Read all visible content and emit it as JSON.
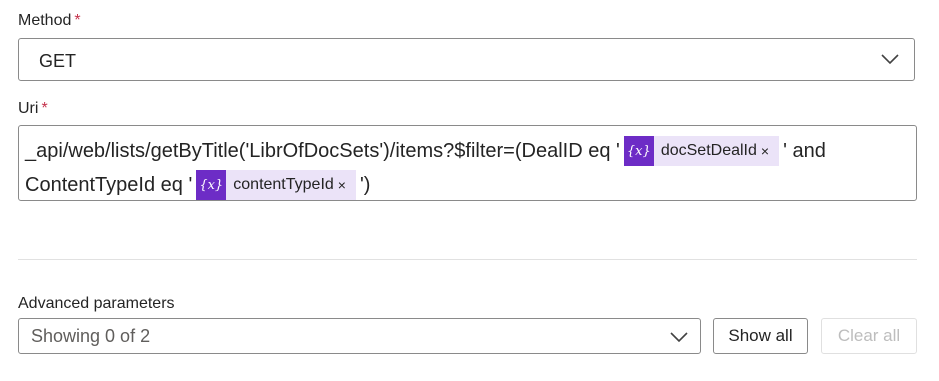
{
  "method": {
    "label": "Method",
    "required_mark": "*",
    "value": "GET"
  },
  "uri": {
    "label": "Uri",
    "required_mark": "*",
    "line1_text": "_api/web/lists/getByTitle('LibrOfDocSets')/items?$filter=(DealID eq '",
    "token1": {
      "icon": "{x}",
      "name": "docSetDealId",
      "remove": "×"
    },
    "line1_after": "' and",
    "line2_text": "ContentTypeId  eq '",
    "token2": {
      "icon": "{x}",
      "name": "contentTypeId",
      "remove": "×"
    },
    "line2_after": "')"
  },
  "advanced": {
    "label": "Advanced parameters",
    "value": "Showing 0 of 2",
    "show_all": "Show all",
    "clear_all": "Clear all"
  },
  "colors": {
    "required": "#c4314b",
    "token_bg": "#ebe3f8",
    "token_icon_bg": "#6d2cc6"
  },
  "icons": [
    "chevron-down-icon",
    "variable-icon",
    "remove-icon"
  ]
}
